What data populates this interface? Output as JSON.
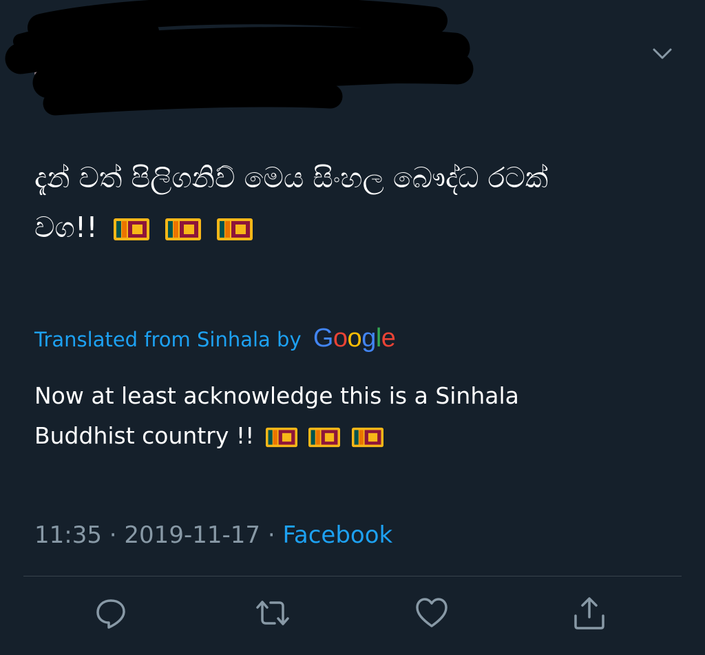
{
  "tweet": {
    "text_line1": "දැන් වත් පිලිගනිව් මෙය සිංහල බෞද්ධ රටක්",
    "text_line2": "වග!!",
    "flag_emoji": "flag-sri-lanka",
    "translated_label": "Translated from Sinhala by",
    "translator_logo": "Google",
    "translation_line1": "Now at least acknowledge this is a Sinhala",
    "translation_line2": "Buddhist country !!",
    "time": "11:35",
    "separator": "·",
    "date": "2019-11-17",
    "source": "Facebook"
  },
  "colors": {
    "background": "#15202b",
    "accent": "#1da1f2",
    "muted": "#8899a6",
    "divider": "#38444d",
    "google_blue": "#4285f4",
    "google_red": "#ea4335",
    "google_yellow": "#fbbc05",
    "google_green": "#34a853"
  },
  "actions": [
    {
      "icon": "reply-icon"
    },
    {
      "icon": "retweet-icon"
    },
    {
      "icon": "like-icon"
    },
    {
      "icon": "share-icon"
    }
  ]
}
